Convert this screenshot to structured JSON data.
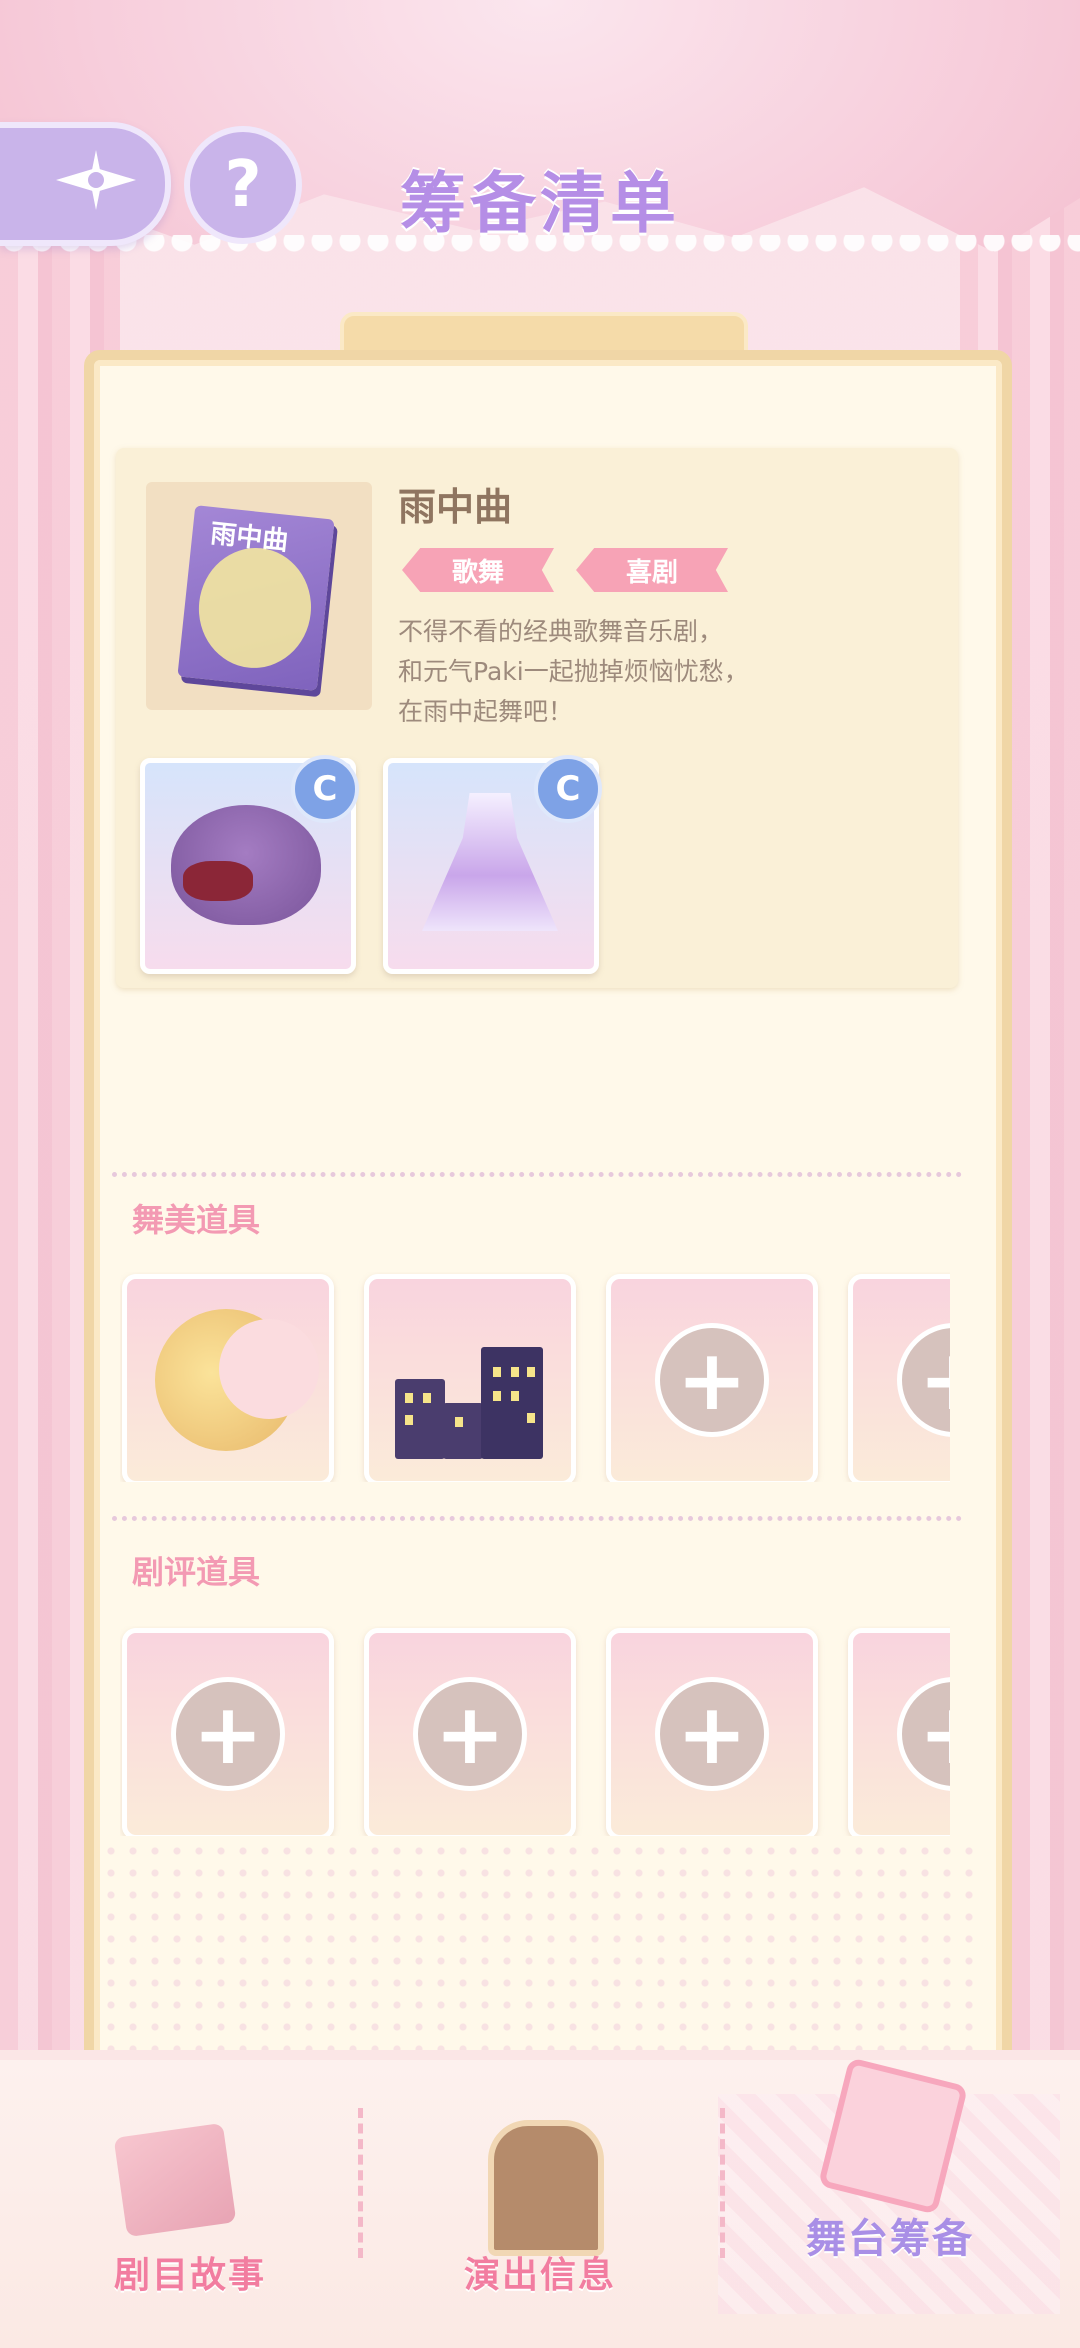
{
  "header": {
    "title": "筹备清单",
    "help_symbol": "?"
  },
  "play": {
    "name": "雨中曲",
    "cover_title": "雨中曲",
    "tags": [
      "歌舞",
      "喜剧"
    ],
    "description_lines": [
      "不得不看的经典歌舞音乐剧，",
      "和元气Paki一起抛掉烦恼忧愁，",
      "在雨中起舞吧！"
    ],
    "costumes": [
      {
        "item": "purple-hat-with-bow",
        "rank": "C"
      },
      {
        "item": "lavender-dress",
        "rank": "C"
      }
    ]
  },
  "sections": {
    "stage_props_title": "舞美道具",
    "review_props_title": "剧评道具",
    "add_symbol": "+"
  },
  "stage_props": [
    {
      "icon": "crescent-moon-icon",
      "filled": true
    },
    {
      "icon": "night-buildings-icon",
      "filled": true
    },
    {
      "icon": "add-slot-icon",
      "filled": false
    },
    {
      "icon": "add-slot-icon",
      "filled": false
    }
  ],
  "review_props": [
    {
      "icon": "add-slot-icon",
      "filled": false
    },
    {
      "icon": "add-slot-icon",
      "filled": false
    },
    {
      "icon": "add-slot-icon",
      "filled": false
    },
    {
      "icon": "add-slot-icon",
      "filled": false
    }
  ],
  "bottom_nav": [
    {
      "label": "剧目故事",
      "icon": "storybook-icon",
      "active": false
    },
    {
      "label": "演出信息",
      "icon": "notice-board-icon",
      "active": false
    },
    {
      "label": "舞台筹备",
      "icon": "clipboard-icon",
      "active": true
    }
  ],
  "colors": {
    "title": "#b58ee6",
    "section_title": "#f39ab3",
    "tag": "#f7a3b6",
    "nav_label": "#f27da0",
    "nav_active": "#a98fe6"
  }
}
